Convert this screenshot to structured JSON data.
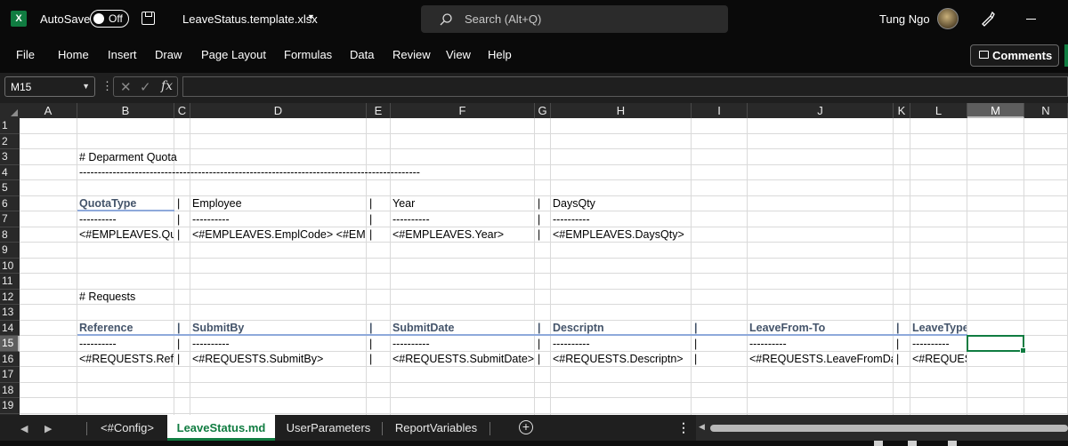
{
  "titlebar": {
    "autosave_label": "AutoSave",
    "autosave_state": "Off",
    "filename": "LeaveStatus.template.xlsx",
    "search_placeholder": "Search (Alt+Q)",
    "user_name": "Tung Ngo"
  },
  "menu": {
    "items": [
      "File",
      "Home",
      "Insert",
      "Draw",
      "Page Layout",
      "Formulas",
      "Data",
      "Review",
      "View",
      "Help"
    ],
    "comments_label": "Comments"
  },
  "formula_bar": {
    "name_box": "M15",
    "formula": ""
  },
  "grid": {
    "columns": [
      "A",
      "B",
      "C",
      "D",
      "E",
      "F",
      "G",
      "H",
      "I",
      "J",
      "K",
      "L",
      "M",
      "N"
    ],
    "selected_column": "M",
    "rows": [
      "1",
      "2",
      "3",
      "4",
      "5",
      "6",
      "7",
      "8",
      "9",
      "10",
      "11",
      "12",
      "13",
      "14",
      "15",
      "16",
      "17",
      "18",
      "19"
    ],
    "selected_row": "15",
    "cells": {
      "B3": "# Deparment Quota",
      "B4": "--------------------------------------------------------------------------------------------",
      "B6": "QuotaType",
      "C6": "|",
      "D6": "Employee",
      "E6": "|",
      "F6": "Year",
      "G6": "|",
      "H6": "DaysQty",
      "B7": "----------",
      "C7": "|",
      "D7": "----------",
      "E7": "|",
      "F7": "----------",
      "G7": "|",
      "H7": "----------",
      "B8": "<#EMPLEAVES.QuotaType>",
      "C8": "|",
      "D8": "<#EMPLEAVES.EmplCode> <#EMPLEAVES.EmplName>",
      "E8": "|",
      "F8": "<#EMPLEAVES.Year>",
      "G8": "|",
      "H8": "<#EMPLEAVES.DaysQty>",
      "B12": "# Requests",
      "B14": "Reference",
      "C14": "|",
      "D14": "SubmitBy",
      "E14": "|",
      "F14": "SubmitDate",
      "G14": "|",
      "H14": "Descriptn",
      "I14": "|",
      "J14": "LeaveFrom-To",
      "K14": "|",
      "L14": "LeaveType",
      "B15": "----------",
      "C15": "|",
      "D15": "----------",
      "E15": "|",
      "F15": "----------",
      "G15": "|",
      "H15": "----------",
      "I15": "|",
      "J15": "----------",
      "K15": "|",
      "L15": "----------",
      "B16": "<#REQUESTS.Reference>",
      "C16": "|",
      "D16": "<#REQUESTS.SubmitBy>",
      "E16": "|",
      "F16": "<#REQUESTS.SubmitDate>",
      "G16": "|",
      "H16": "<#REQUESTS.Descriptn>",
      "I16": "|",
      "J16": "<#REQUESTS.LeaveFromDate>",
      "K16": "|",
      "L16": "<#REQUESTS.LeaveType>"
    }
  },
  "sheets": {
    "tabs": [
      "<#Config>",
      "LeaveStatus.md",
      "UserParameters",
      "ReportVariables"
    ],
    "active": "LeaveStatus.md"
  },
  "colors": {
    "excel_green": "#107c41",
    "header_text_blue": "#44546a",
    "underline_blue": "#8ea9db"
  }
}
